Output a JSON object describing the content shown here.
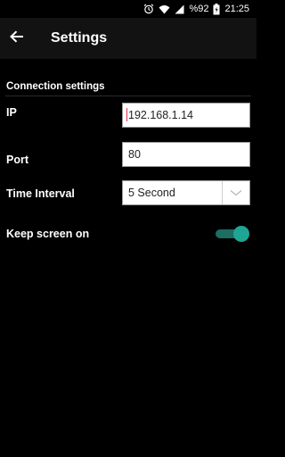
{
  "status_bar": {
    "battery_percent": "%92",
    "time": "21:25",
    "icons": [
      "alarm-icon",
      "wifi-icon",
      "signal-icon",
      "battery-icon"
    ]
  },
  "app_bar": {
    "title": "Settings",
    "back_icon": "arrow-left-icon"
  },
  "connection": {
    "section_title": "Connection settings",
    "ip_label": "IP",
    "ip_value": "192.168.1.14",
    "port_label": "Port",
    "port_value": "80",
    "interval_label": "Time Interval",
    "interval_value": "5 Second",
    "keep_screen_label": "Keep screen on",
    "keep_screen_on": true
  },
  "colors": {
    "background": "#000000",
    "app_bar": "#121212",
    "accent": "#1fa594",
    "caret": "#e0344a"
  }
}
